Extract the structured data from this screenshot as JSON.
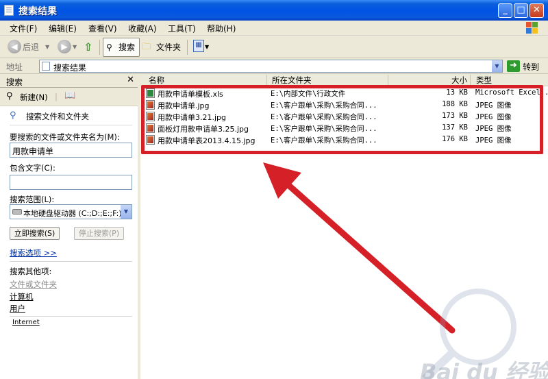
{
  "window": {
    "title": "搜索结果"
  },
  "menu": [
    "文件(F)",
    "编辑(E)",
    "查看(V)",
    "收藏(A)",
    "工具(T)",
    "帮助(H)"
  ],
  "toolbar": {
    "back": "后退",
    "search": "搜索",
    "folders": "文件夹"
  },
  "address": {
    "label": "地址",
    "value": "搜索结果",
    "go": "转到"
  },
  "search_pane": {
    "title": "搜索",
    "new_label": "新建(N)",
    "section_title": "搜索文件和文件夹",
    "filename_label": "要搜索的文件或文件夹名为(M):",
    "filename_value": "用款申请单",
    "contains_label": "包含文字(C):",
    "contains_value": "",
    "scope_label": "搜索范围(L):",
    "scope_value": "本地硬盘驱动器 (C:;D:;E:;F:)",
    "search_now": "立即搜索(S)",
    "stop_search": "停止搜索(P)",
    "options_link": "搜索选项 >>",
    "other_title": "搜索其他项:",
    "other_items": [
      "文件或文件夹",
      "计算机",
      "用户",
      "Internet"
    ]
  },
  "list": {
    "columns": [
      "名称",
      "所在文件夹",
      "大小",
      "类型"
    ],
    "rows": [
      {
        "name": "用款申请单模板.xls",
        "folder": "E:\\内部文件\\行政文件",
        "size": "13 KB",
        "type": "Microsoft Excel...",
        "icon": "excel-file-icon"
      },
      {
        "name": "用款申请单.jpg",
        "folder": "E:\\客户跟单\\采购\\采购合同...",
        "size": "188 KB",
        "type": "JPEG 图像",
        "icon": "jpeg-file-icon"
      },
      {
        "name": "用款申请单3.21.jpg",
        "folder": "E:\\客户跟单\\采购\\采购合同...",
        "size": "173 KB",
        "type": "JPEG 图像",
        "icon": "jpeg-file-icon"
      },
      {
        "name": "面板灯用款申请单3.25.jpg",
        "folder": "E:\\客户跟单\\采购\\采购合同...",
        "size": "137 KB",
        "type": "JPEG 图像",
        "icon": "jpeg-file-icon"
      },
      {
        "name": "用款申请单表2013.4.15.jpg",
        "folder": "E:\\客户跟单\\采购\\采购合同...",
        "size": "176 KB",
        "type": "JPEG 图像",
        "icon": "jpeg-file-icon"
      }
    ]
  },
  "annotation": {
    "highlight_color": "#d62028"
  },
  "watermark": "Bai du 经验"
}
